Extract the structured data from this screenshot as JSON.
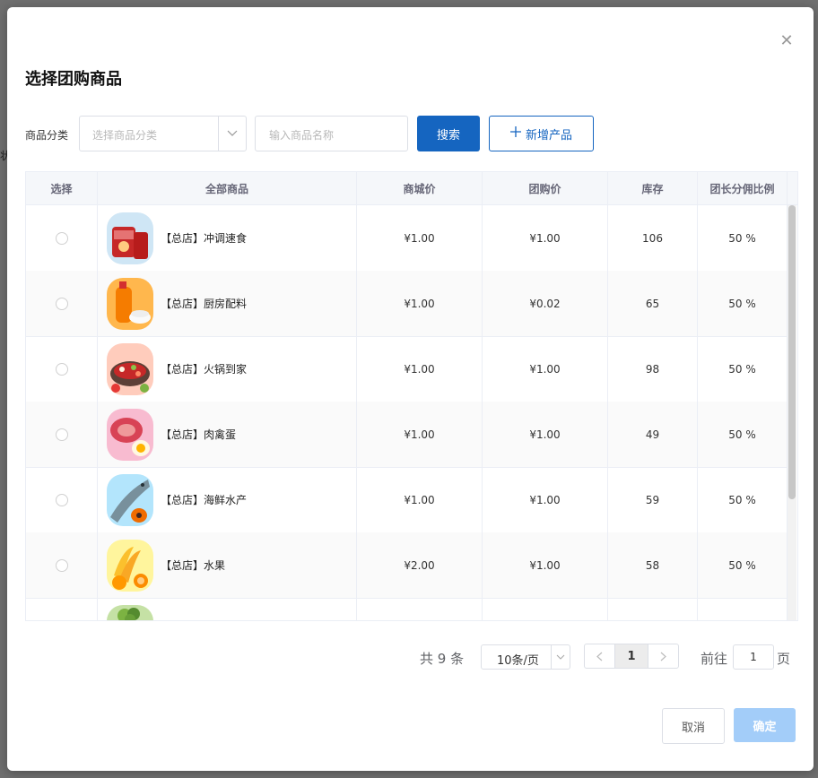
{
  "background": {
    "stub_text": "状"
  },
  "dialog": {
    "title": "选择团购商品",
    "close_icon": "close-icon"
  },
  "filter": {
    "category_label": "商品分类",
    "category_placeholder": "选择商品分类",
    "name_placeholder": "输入商品名称",
    "search_label": "搜索",
    "add_label": "新增产品"
  },
  "table": {
    "headers": [
      "选择",
      "全部商品",
      "商城价",
      "团购价",
      "库存",
      "团长分佣比例"
    ],
    "rows": [
      {
        "name": "【总店】冲调速食",
        "mall_price": "¥1.00",
        "group_price": "¥1.00",
        "stock": "106",
        "ratio": "50 %",
        "thumb_color": "#c62828"
      },
      {
        "name": "【总店】厨房配料",
        "mall_price": "¥1.00",
        "group_price": "¥0.02",
        "stock": "65",
        "ratio": "50 %",
        "thumb_color": "#f57c00"
      },
      {
        "name": "【总店】火锅到家",
        "mall_price": "¥1.00",
        "group_price": "¥1.00",
        "stock": "98",
        "ratio": "50 %",
        "thumb_color": "#b23a2a"
      },
      {
        "name": "【总店】肉禽蛋",
        "mall_price": "¥1.00",
        "group_price": "¥1.00",
        "stock": "49",
        "ratio": "50 %",
        "thumb_color": "#d84355"
      },
      {
        "name": "【总店】海鲜水产",
        "mall_price": "¥1.00",
        "group_price": "¥1.00",
        "stock": "59",
        "ratio": "50 %",
        "thumb_color": "#607d8b"
      },
      {
        "name": "【总店】水果",
        "mall_price": "¥2.00",
        "group_price": "¥1.00",
        "stock": "58",
        "ratio": "50 %",
        "thumb_color": "#f9a825"
      },
      {
        "name": "",
        "mall_price": "",
        "group_price": "",
        "stock": "",
        "ratio": "",
        "thumb_color": "#7cb342"
      }
    ]
  },
  "pagination": {
    "total_text": "共 9 条",
    "page_size": "10条/页",
    "current_page": "1",
    "goto_label": "前往",
    "goto_value": "1",
    "page_suffix": "页"
  },
  "footer": {
    "cancel_label": "取消",
    "ok_label": "确定"
  }
}
